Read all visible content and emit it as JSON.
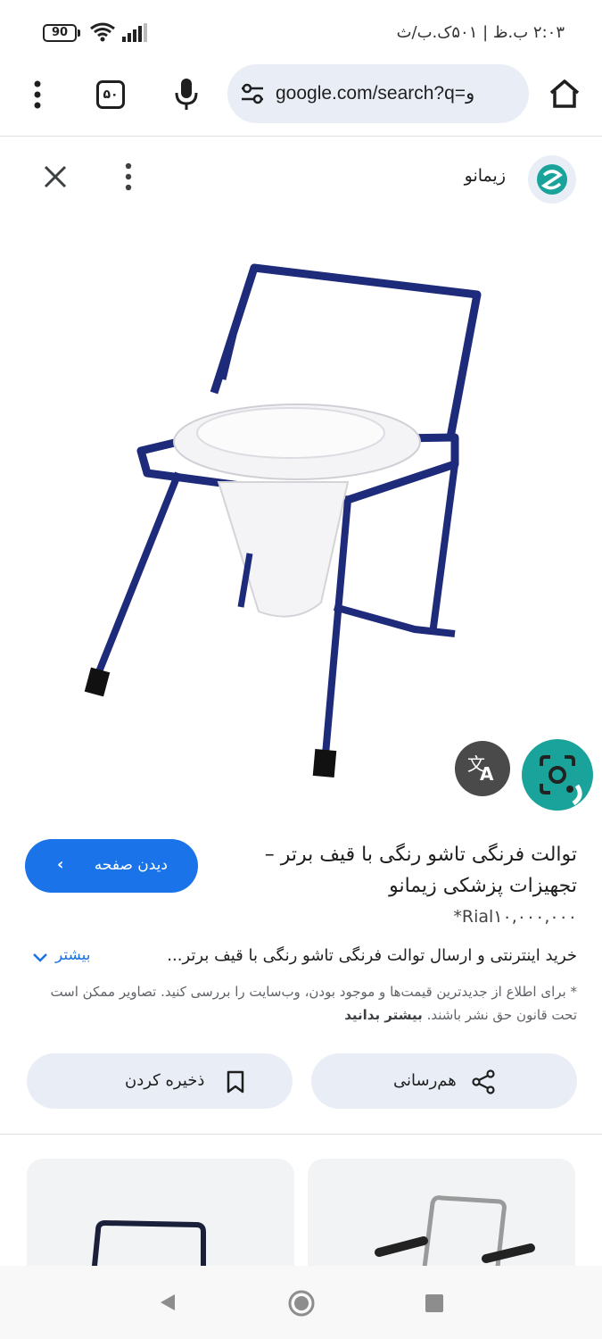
{
  "status_bar": {
    "battery": "90",
    "time": "۲:۰۳ ب.ظ | ۵۰۱ک.ب/ث"
  },
  "toolbar": {
    "tab_count": "۵۰",
    "url": "google.com/search?q=و"
  },
  "panel": {
    "site_name": "زیمانو",
    "title": "توالت فرنگی تاشو رنگی با قیف برتر – تجهیزات پزشکی زیمانو",
    "price": "*Rial۱۰,۰۰۰,۰۰۰",
    "visit_label": "دیدن صفحه",
    "snippet": "خرید اینترنتی و ارسال توالت فرنگی تاشو رنگی با قیف برتر...",
    "more_label": "بیشتر",
    "disclaimer": "* برای اطلاع از جدیدترین قیمت‌ها و موجود بودن، وب‌سایت را بررسی کنید. تصاویر ممکن است تحت قانون حق نشر باشند.",
    "disclaimer_link": "بیشتر بدانید",
    "share_label": "هم‌رسانی",
    "save_label": "ذخیره کردن"
  },
  "colors": {
    "accent": "#1a73e8",
    "chip_bg": "#e9eef6",
    "frame_blue": "#1e2a7a",
    "lens_teal": "#1aa39a"
  },
  "icons": [
    "battery-icon",
    "wifi-icon",
    "signal-icon",
    "menu-dots-icon",
    "mic-icon",
    "tune-icon",
    "home-icon",
    "close-icon",
    "translate-icon",
    "lens-icon",
    "chevron-left-icon",
    "chevron-down-icon",
    "share-icon",
    "bookmark-icon"
  ]
}
